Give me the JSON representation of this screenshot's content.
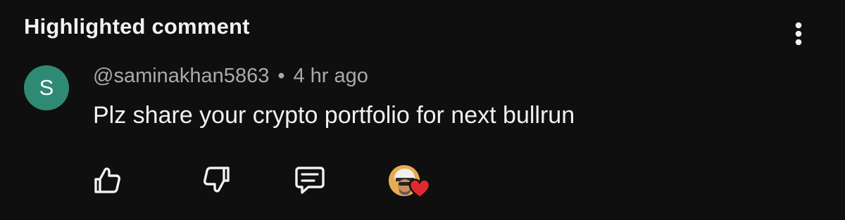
{
  "header": {
    "title": "Highlighted comment",
    "menu_icon": "more-vertical-icon"
  },
  "comment": {
    "avatar_letter": "S",
    "avatar_color": "#2f8a74",
    "author": "@saminakhan5863",
    "separator": "•",
    "time": "4 hr ago",
    "text": "Plz share your crypto portfolio for next bullrun"
  },
  "actions": {
    "like_icon": "thumbs-up-icon",
    "dislike_icon": "thumbs-down-icon",
    "reply_icon": "reply-icon",
    "creator_heart_icon": "heart-icon",
    "heart_color": "#e2282f"
  }
}
